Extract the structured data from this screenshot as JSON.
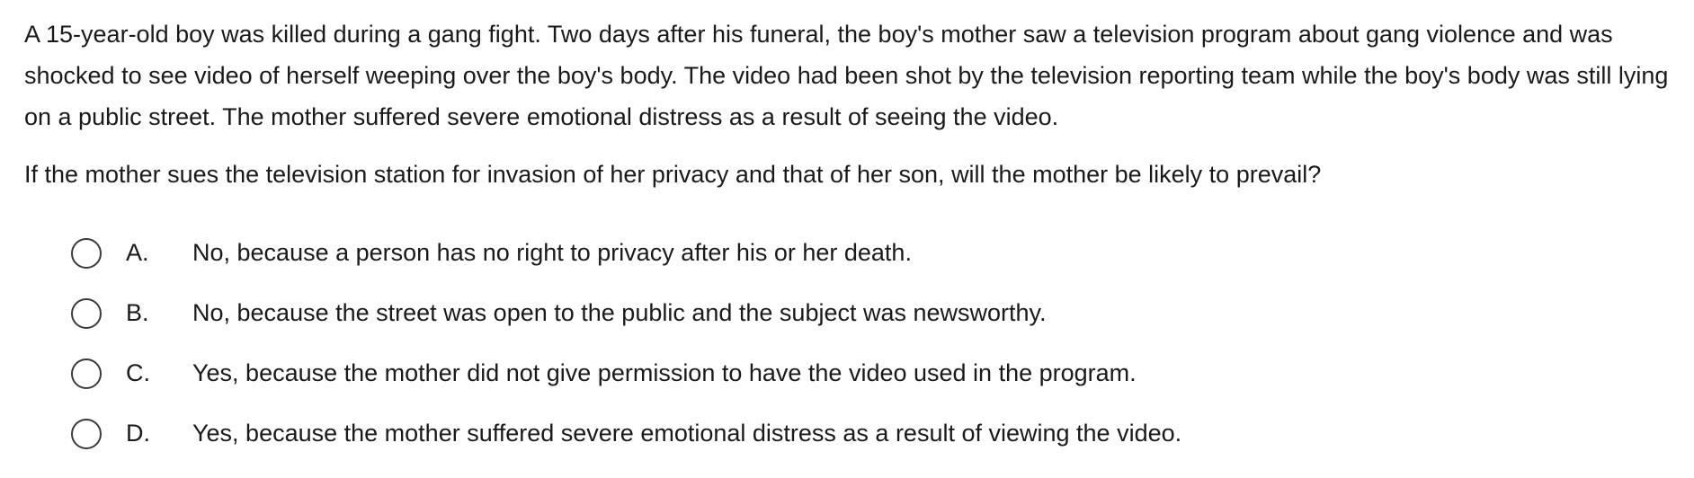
{
  "stem": "A 15-year-old boy was killed during a gang fight.  Two days after his funeral, the boy's mother saw a television program about gang violence and was shocked to see video of herself weeping over the boy's body.  The video had been shot by the television reporting team while the boy's body was still lying on a public street.  The mother suffered severe emotional distress as a result of seeing the video.",
  "question": "If the mother sues the television station for invasion of her privacy and that of her son, will the mother be likely to prevail?",
  "options": [
    {
      "letter": "A.",
      "text": "No, because a person has no right to privacy after his or her death."
    },
    {
      "letter": "B.",
      "text": "No, because the street was open to the public and the subject was newsworthy."
    },
    {
      "letter": "C.",
      "text": "Yes, because the mother did not give permission to have the video used in the program."
    },
    {
      "letter": "D.",
      "text": "Yes, because the mother suffered severe emotional distress as a result of viewing the video."
    }
  ]
}
